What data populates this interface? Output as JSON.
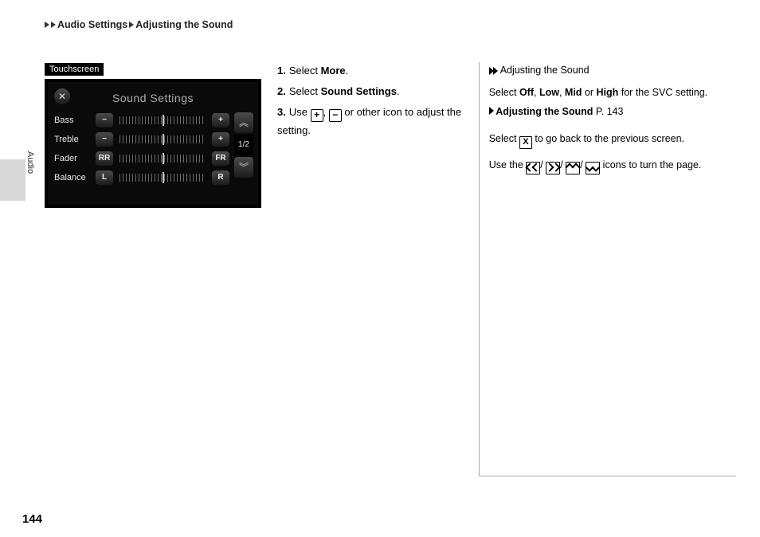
{
  "header": {
    "crumb1": "Audio Settings",
    "crumb2": "Adjusting the Sound"
  },
  "sideTab": "Audio",
  "tag": "Touchscreen",
  "screenshot": {
    "title": "Sound Settings",
    "close": "✕",
    "rows": [
      {
        "label": "Bass",
        "left": "−",
        "right": "+"
      },
      {
        "label": "Treble",
        "left": "−",
        "right": "+"
      },
      {
        "label": "Fader",
        "left": "RR",
        "right": "FR"
      },
      {
        "label": "Balance",
        "left": "L",
        "right": "R"
      }
    ],
    "pager": {
      "up": "︽",
      "mid": "1/2",
      "down": "︾"
    }
  },
  "steps": {
    "s1": {
      "n": "1.",
      "pre": "Select ",
      "b": "More",
      "post": "."
    },
    "s2": {
      "n": "2.",
      "pre": "Select ",
      "b": "Sound Settings",
      "post": "."
    },
    "s3": {
      "n": "3.",
      "pre": "Use ",
      "mid": ", ",
      "post": " or other icon to adjust the setting.",
      "plus": "+",
      "minus": "−"
    }
  },
  "right": {
    "title": "Adjusting the Sound",
    "line1a": "Select ",
    "off": "Off",
    "comma": ", ",
    "low": "Low",
    "mid": "Mid",
    "or": " or ",
    "high": "High",
    "line1b": " for the SVC setting.",
    "linkArrow": "❯",
    "linkText": "Adjusting the Sound",
    "linkPage": " P. 143",
    "line2a": "Select ",
    "x": "X",
    "line2b": " to go back to the previous screen.",
    "line3a": "Use the ",
    "slash": "/",
    "line3b": " icons to turn the page."
  },
  "pageNum": "144"
}
